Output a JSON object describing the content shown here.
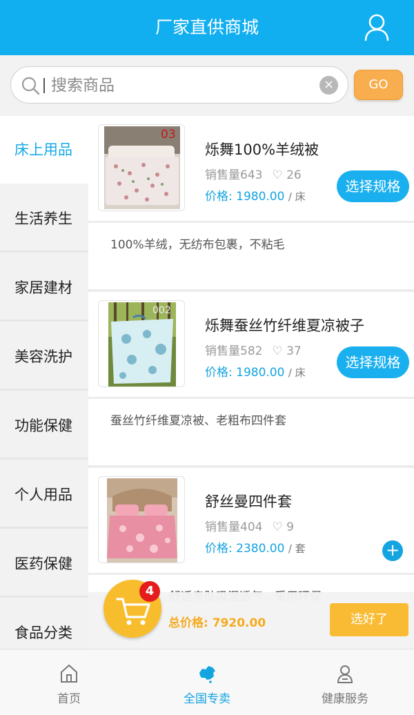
{
  "header": {
    "title": "厂家直供商城",
    "icon": "user-icon"
  },
  "search": {
    "placeholder": "搜索商品",
    "go_label": "GO"
  },
  "sidebar": {
    "items": [
      {
        "label": "床上用品",
        "active": true
      },
      {
        "label": "生活养生"
      },
      {
        "label": "家居建材"
      },
      {
        "label": "美容洗护"
      },
      {
        "label": "功能保健"
      },
      {
        "label": "个人用品"
      },
      {
        "label": "医药保健"
      },
      {
        "label": "食品分类"
      }
    ]
  },
  "products": [
    {
      "tag": "03",
      "name": "烁舞100%羊绒被",
      "sales": "销售量643",
      "likes": "26",
      "price_label": "价格:",
      "price": "1980.00",
      "unit": "/ 床",
      "action": "选择规格",
      "desc": "100%羊绒，无纺布包裹，不粘毛"
    },
    {
      "tag": "002",
      "name": "烁舞蚕丝竹纤维夏凉被子",
      "sales": "销售量582",
      "likes": "37",
      "price_label": "价格:",
      "price": "1980.00",
      "unit": "/ 床",
      "action": "选择规格",
      "desc": "蚕丝竹纤维夏凉被、老粗布四件套"
    },
    {
      "tag": "",
      "name": "舒丝曼四件套",
      "sales": "销售量404",
      "likes": "9",
      "price_label": "价格:",
      "price": "2380.00",
      "unit": "/ 套",
      "action": "+",
      "desc": "提花系列，舒适亲肤吸湿透气，采用环保"
    }
  ],
  "cart": {
    "count": "4",
    "total": "总价格: 7920.00",
    "done_label": "选好了"
  },
  "tabs": [
    {
      "label": "首页",
      "icon": "home-icon"
    },
    {
      "label": "全国专卖",
      "icon": "china-map-icon",
      "active": true
    },
    {
      "label": "健康服务",
      "icon": "health-service-icon"
    }
  ],
  "colors": {
    "primary": "#11aef0",
    "accent": "#f8bd2d",
    "go": "#f8ad4e",
    "badge": "#e41c1c"
  }
}
